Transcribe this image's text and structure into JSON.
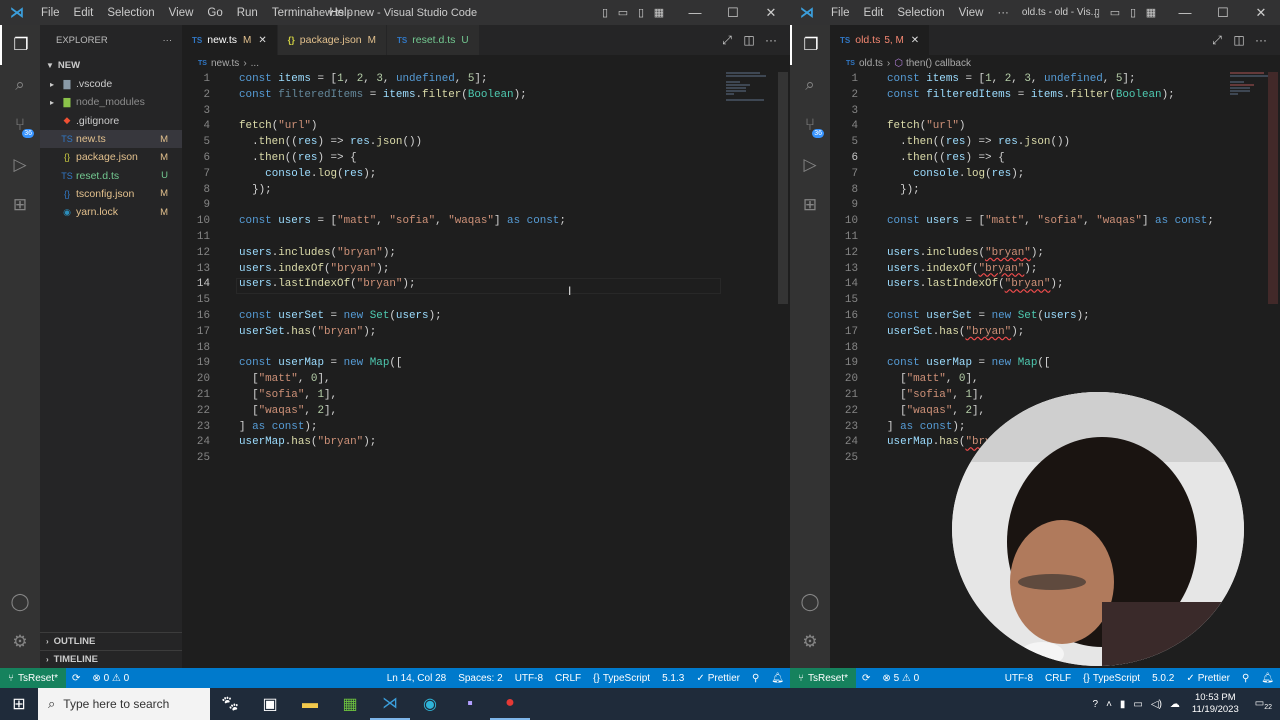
{
  "left": {
    "menu": [
      "File",
      "Edit",
      "Selection",
      "View",
      "Go",
      "Run",
      "Terminal",
      "Help"
    ],
    "title": "new.ts - new - Visual Studio Code",
    "explorer": {
      "header": "EXPLORER",
      "folder": "NEW",
      "items": [
        {
          "name": ".vscode",
          "status": ""
        },
        {
          "name": "node_modules",
          "status": ""
        },
        {
          "name": ".gitignore",
          "status": ""
        },
        {
          "name": "new.ts",
          "status": "M"
        },
        {
          "name": "package.json",
          "status": "M"
        },
        {
          "name": "reset.d.ts",
          "status": "U"
        },
        {
          "name": "tsconfig.json",
          "status": "M"
        },
        {
          "name": "yarn.lock",
          "status": "M"
        }
      ],
      "outline": "OUTLINE",
      "timeline": "TIMELINE"
    },
    "tabs": [
      {
        "label": "new.ts",
        "status": "M",
        "icon": "TS"
      },
      {
        "label": "package.json",
        "status": "M",
        "icon": "{}"
      },
      {
        "label": "reset.d.ts",
        "status": "U",
        "icon": "TS"
      }
    ],
    "breadcrumb": [
      "new.ts",
      "..."
    ],
    "status": {
      "branch": "TsReset*",
      "problems": "⊗ 0 ⚠ 0",
      "position": "Ln 14, Col 28",
      "spaces": "Spaces: 2",
      "encoding": "UTF-8",
      "eol": "CRLF",
      "language": "TypeScript",
      "version": "5.1.3",
      "formatter": "Prettier"
    }
  },
  "right": {
    "menu": [
      "File",
      "Edit",
      "Selection",
      "View",
      "···"
    ],
    "title": "old.ts - old - Vis...",
    "tab": {
      "label": "old.ts",
      "status": "5, M"
    },
    "breadcrumb": [
      "old.ts",
      "then() callback"
    ],
    "status": {
      "branch": "TsReset*",
      "problems": "⊗ 5 ⚠ 0",
      "encoding": "UTF-8",
      "eol": "CRLF",
      "language": "TypeScript",
      "version": "5.0.2",
      "formatter": "Prettier"
    }
  },
  "code_lines": [
    "const items = [1, 2, 3, undefined, 5];",
    "const filteredItems = items.filter(Boolean);",
    "",
    "fetch(\"url\")",
    "  .then((res) => res.json())",
    "  .then((res) => {",
    "    console.log(res);",
    "  });",
    "",
    "const users = [\"matt\", \"sofia\", \"waqas\"] as const;",
    "",
    "users.includes(\"bryan\");",
    "users.indexOf(\"bryan\");",
    "users.lastIndexOf(\"bryan\");",
    "",
    "const userSet = new Set(users);",
    "userSet.has(\"bryan\");",
    "",
    "const userMap = new Map([",
    "  [\"matt\", 0],",
    "  [\"sofia\", 1],",
    "  [\"waqas\", 2],",
    "] as const);",
    "userMap.has(\"bryan\");",
    ""
  ],
  "taskbar": {
    "search_placeholder": "Type here to search",
    "time": "10:53 PM",
    "date": "11/19/2023",
    "notification_count": "22"
  }
}
